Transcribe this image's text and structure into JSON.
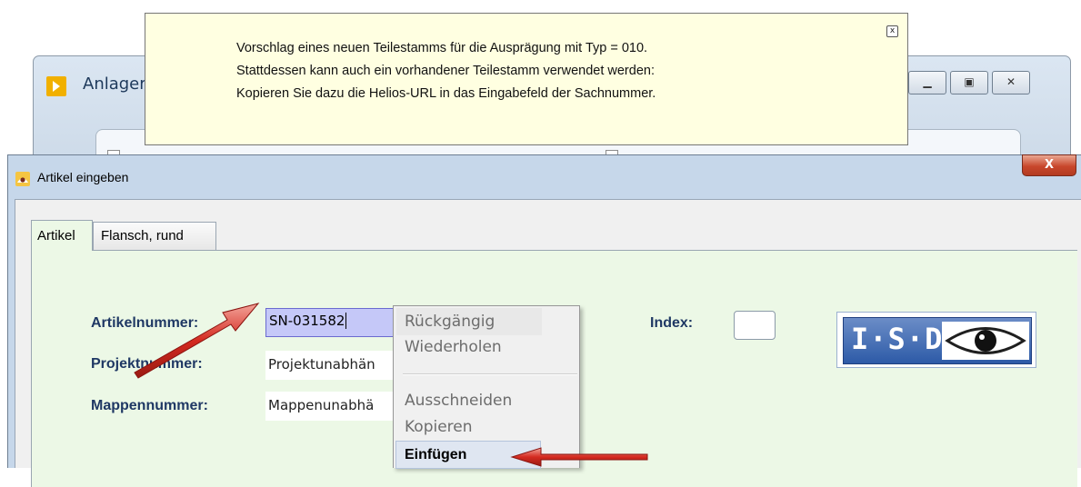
{
  "background_window": {
    "title": "Anlager",
    "buttons": {
      "minimize_icon": "minimize-icon",
      "maximize_icon": "maximize-icon",
      "close_icon": "close-icon"
    }
  },
  "tooltip": {
    "lines": [
      "Vorschlag eines neuen Teilestamms für die Ausprägung mit Typ = 010.",
      "Stattdessen kann auch ein vorhandener Teilestamm verwendet werden:",
      "Kopieren Sie dazu die Helios-URL in das Eingabefeld der Sachnummer."
    ],
    "close_glyph": "x"
  },
  "dialog": {
    "title": "Artikel eingeben",
    "close_glyph": "X",
    "tabs": [
      {
        "label": "Artikel",
        "active": true
      },
      {
        "label": "Flansch, rund",
        "active": false
      }
    ],
    "fields": {
      "artikelnummer": {
        "label": "Artikelnummer:",
        "value": "SN-031582"
      },
      "projektnummer": {
        "label": "Projektnummer:",
        "value": "Projektunabhän"
      },
      "mappennummer": {
        "label": "Mappennummer:",
        "value": "Mappenunabhä"
      },
      "index": {
        "label": "Index:",
        "value": ""
      }
    },
    "logo": {
      "text": "I·S·D"
    }
  },
  "context_menu": {
    "items": [
      {
        "label": "Rückgängig",
        "enabled": false
      },
      {
        "label": "Wiederholen",
        "enabled": false
      },
      {
        "label": "Ausschneiden",
        "enabled": false
      },
      {
        "label": "Kopieren",
        "enabled": false
      },
      {
        "label": "Einfügen",
        "enabled": true
      }
    ]
  },
  "colors": {
    "tooltip_bg": "#ffffe1",
    "tab_panel_bg": "#ecf8e6",
    "label_color": "#1f3864",
    "selection_bg": "#c5c8f8",
    "annotation_arrow": "#d42a20",
    "close_button": "#c8472c"
  }
}
